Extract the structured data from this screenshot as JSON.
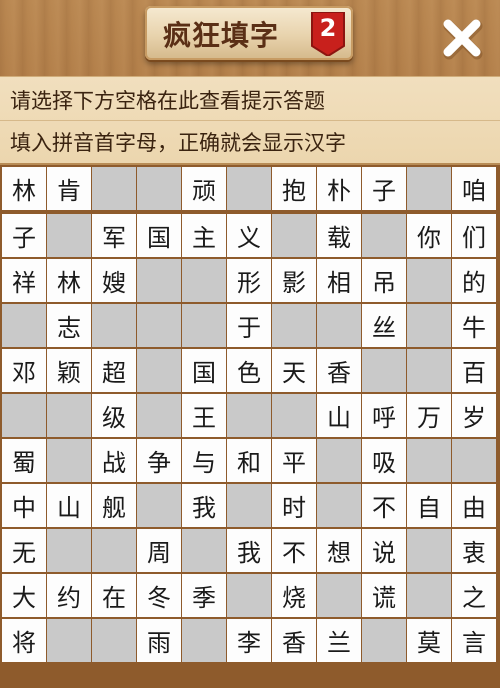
{
  "header": {
    "title": "疯狂填字",
    "level": "2",
    "close_icon": "close-icon"
  },
  "hints": {
    "line1": "请选择下方空格在此查看提示答题",
    "line2": "填入拼音首字母，正确就会显示汉字"
  },
  "colors": {
    "wood": "#a8743f",
    "cell_white": "#fdfdfd",
    "cell_blank": "#c9c9c9",
    "badge_red": "#c8201c"
  },
  "grid": {
    "rows": [
      [
        "林",
        "肯",
        "",
        "",
        "顽",
        "",
        "抱",
        "朴",
        "子",
        "",
        "咱"
      ],
      [
        "子",
        "",
        "军",
        "国",
        "主",
        "义",
        "",
        "载",
        "",
        "你",
        "们"
      ],
      [
        "祥",
        "林",
        "嫂",
        "",
        "",
        "形",
        "影",
        "相",
        "吊",
        "",
        "的"
      ],
      [
        "",
        "志",
        "",
        "",
        "",
        "于",
        "",
        "",
        "丝",
        "",
        "牛"
      ],
      [
        "邓",
        "颖",
        "超",
        "",
        "国",
        "色",
        "天",
        "香",
        "",
        "",
        "百"
      ],
      [
        "",
        "",
        "级",
        "",
        "王",
        "",
        "",
        "山",
        "呼",
        "万",
        "岁"
      ],
      [
        "蜀",
        "",
        "战",
        "争",
        "与",
        "和",
        "平",
        "",
        "吸",
        "",
        ""
      ],
      [
        "中",
        "山",
        "舰",
        "",
        "我",
        "",
        "时",
        "",
        "不",
        "自",
        "由"
      ],
      [
        "无",
        "",
        "",
        "周",
        "",
        "我",
        "不",
        "想",
        "说",
        "",
        "衷"
      ],
      [
        "大",
        "约",
        "在",
        "冬",
        "季",
        "",
        "烧",
        "",
        "谎",
        "",
        "之"
      ],
      [
        "将",
        "",
        "",
        "雨",
        "",
        "李",
        "香",
        "兰",
        "",
        "莫",
        "言"
      ]
    ],
    "blank_mask": [
      [
        0,
        0,
        1,
        1,
        0,
        1,
        0,
        0,
        0,
        1,
        0
      ],
      [
        0,
        1,
        0,
        0,
        0,
        0,
        1,
        0,
        1,
        0,
        0
      ],
      [
        0,
        0,
        0,
        1,
        1,
        0,
        0,
        0,
        0,
        1,
        0
      ],
      [
        1,
        0,
        1,
        1,
        1,
        0,
        1,
        1,
        0,
        1,
        0
      ],
      [
        0,
        0,
        0,
        1,
        0,
        0,
        0,
        0,
        1,
        1,
        0
      ],
      [
        1,
        1,
        0,
        1,
        0,
        1,
        1,
        0,
        0,
        0,
        0
      ],
      [
        0,
        1,
        0,
        0,
        0,
        0,
        0,
        1,
        0,
        1,
        1
      ],
      [
        0,
        0,
        0,
        1,
        0,
        1,
        0,
        1,
        0,
        0,
        0
      ],
      [
        0,
        1,
        1,
        0,
        1,
        0,
        0,
        0,
        0,
        1,
        0
      ],
      [
        0,
        0,
        0,
        0,
        0,
        1,
        0,
        1,
        0,
        1,
        0
      ],
      [
        0,
        1,
        1,
        0,
        1,
        0,
        0,
        0,
        1,
        0,
        0
      ]
    ]
  }
}
